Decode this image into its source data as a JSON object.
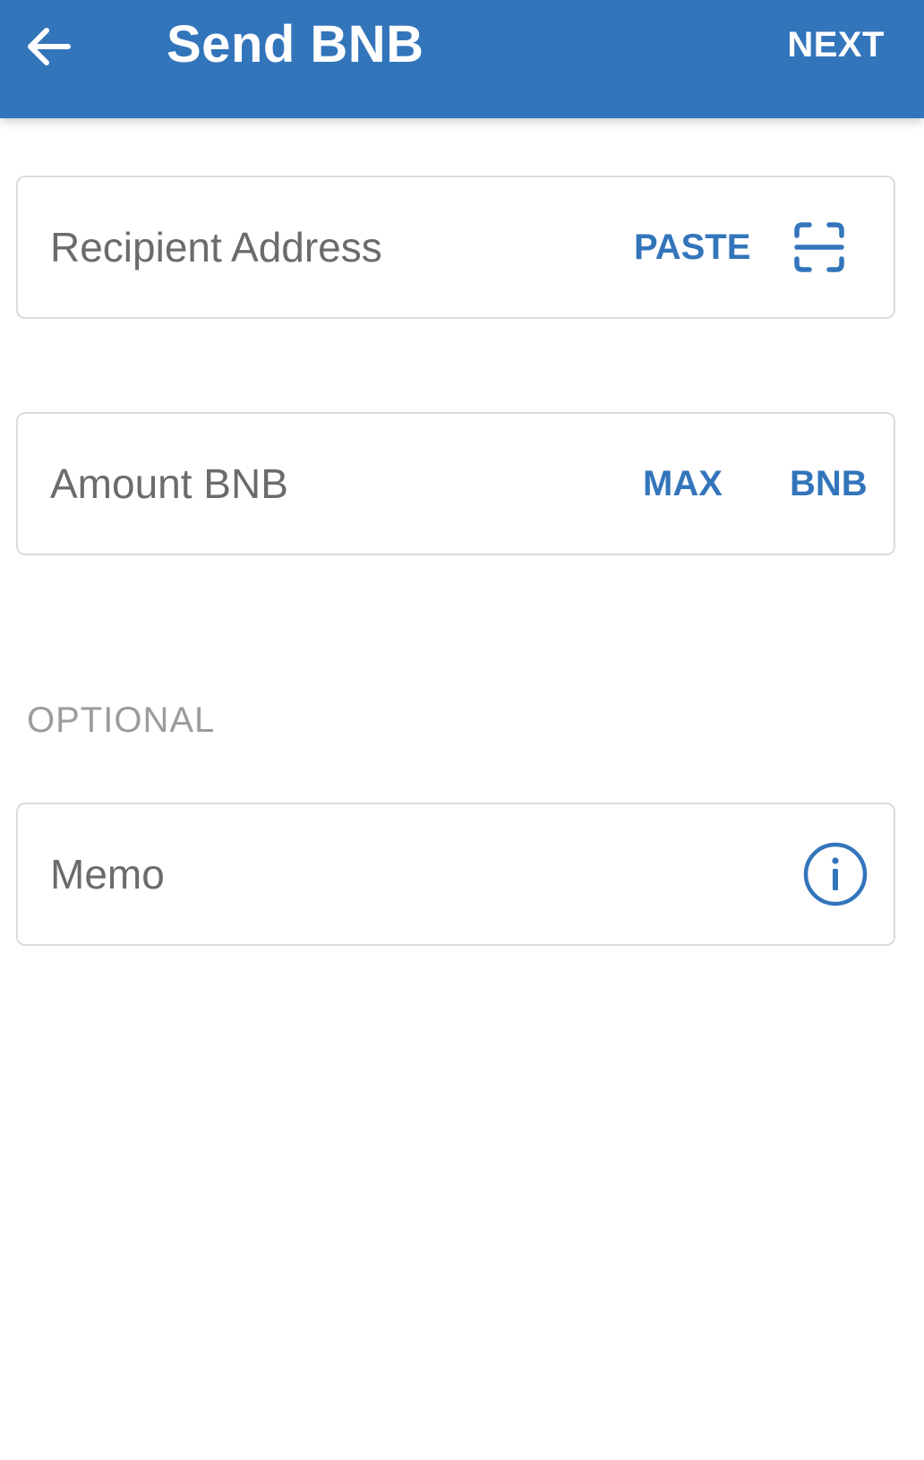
{
  "app_bar": {
    "title": "Send BNB",
    "next_label": "NEXT",
    "back_icon": "arrow-left-icon",
    "background_color": "#3375bb"
  },
  "recipient": {
    "placeholder": "Recipient Address",
    "paste_label": "PASTE",
    "scan_icon": "qr-scan-icon"
  },
  "amount": {
    "placeholder": "Amount BNB",
    "max_label": "MAX",
    "currency_label": "BNB"
  },
  "optional": {
    "section_label": "OPTIONAL",
    "memo_placeholder": "Memo",
    "info_icon": "info-icon"
  },
  "colors": {
    "accent": "#3375bb",
    "placeholder_text": "#6b6b6b",
    "section_label": "#9c9c9c",
    "border": "#dcdcdc"
  }
}
